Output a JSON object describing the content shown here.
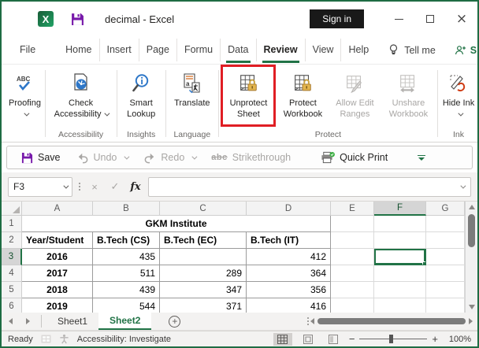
{
  "window": {
    "doc_title": "decimal  -  Excel",
    "sign_in_label": "Sign in"
  },
  "menu": {
    "tabs": [
      "File",
      "Home",
      "Insert",
      "Page",
      "Formu",
      "Data",
      "Review",
      "View",
      "Help"
    ],
    "active_tab": "Review",
    "tell_me_label": "Tell me",
    "share_label": "Share"
  },
  "ribbon": {
    "proofing": {
      "label": "Proofing"
    },
    "check_accessibility": {
      "label": "Check Accessibility"
    },
    "smart_lookup": {
      "label": "Smart Lookup"
    },
    "translate": {
      "label": "Translate"
    },
    "unprotect_sheet": {
      "label": "Unprotect Sheet",
      "highlighted": true
    },
    "protect_workbook": {
      "label": "Protect Workbook"
    },
    "allow_edit_ranges": {
      "label": "Allow Edit Ranges",
      "disabled": true
    },
    "unshare_workbook": {
      "label": "Unshare Workbook",
      "disabled": true
    },
    "hide_ink": {
      "label": "Hide Ink"
    },
    "groups": {
      "accessibility": "Accessibility",
      "insights": "Insights",
      "language": "Language",
      "protect": "Protect",
      "ink": "Ink"
    }
  },
  "quick_access": {
    "save": "Save",
    "undo": "Undo",
    "redo": "Redo",
    "strikethrough": "Strikethrough",
    "quick_print": "Quick Print"
  },
  "formula_bar": {
    "name_box": "F3",
    "fx_label": "fx",
    "formula_value": ""
  },
  "sheet": {
    "column_headers": [
      "A",
      "B",
      "C",
      "D",
      "E",
      "F",
      "G"
    ],
    "selected_column": "F",
    "selected_row": "3",
    "selected_cell": "F3",
    "rows": [
      {
        "n": "1",
        "merged": true,
        "cells": [
          "GKM Institute",
          "",
          "",
          ""
        ]
      },
      {
        "n": "2",
        "merged": false,
        "cells": [
          "Year/Student",
          "B.Tech (CS)",
          "B.Tech (EC)",
          "B.Tech (IT)"
        ]
      },
      {
        "n": "3",
        "merged": false,
        "cells": [
          "2016",
          "435",
          "",
          "412"
        ]
      },
      {
        "n": "4",
        "merged": false,
        "cells": [
          "2017",
          "511",
          "289",
          "364"
        ]
      },
      {
        "n": "5",
        "merged": false,
        "cells": [
          "2018",
          "439",
          "347",
          "356"
        ]
      },
      {
        "n": "6",
        "merged": false,
        "cells": [
          "2019",
          "544",
          "371",
          "416"
        ]
      }
    ]
  },
  "sheet_tabs": {
    "tabs": [
      "Sheet1",
      "Sheet2"
    ],
    "active": "Sheet2"
  },
  "status_bar": {
    "mode": "Ready",
    "accessibility": "Accessibility: Investigate",
    "zoom_level": "100%"
  },
  "colors": {
    "excel_green": "#217346",
    "highlight_red": "#e01e24",
    "save_purple": "#7719aa",
    "lock_gold": "#e3b54d",
    "icon_blue": "#2e77c8",
    "ink_red": "#cf3c14"
  }
}
